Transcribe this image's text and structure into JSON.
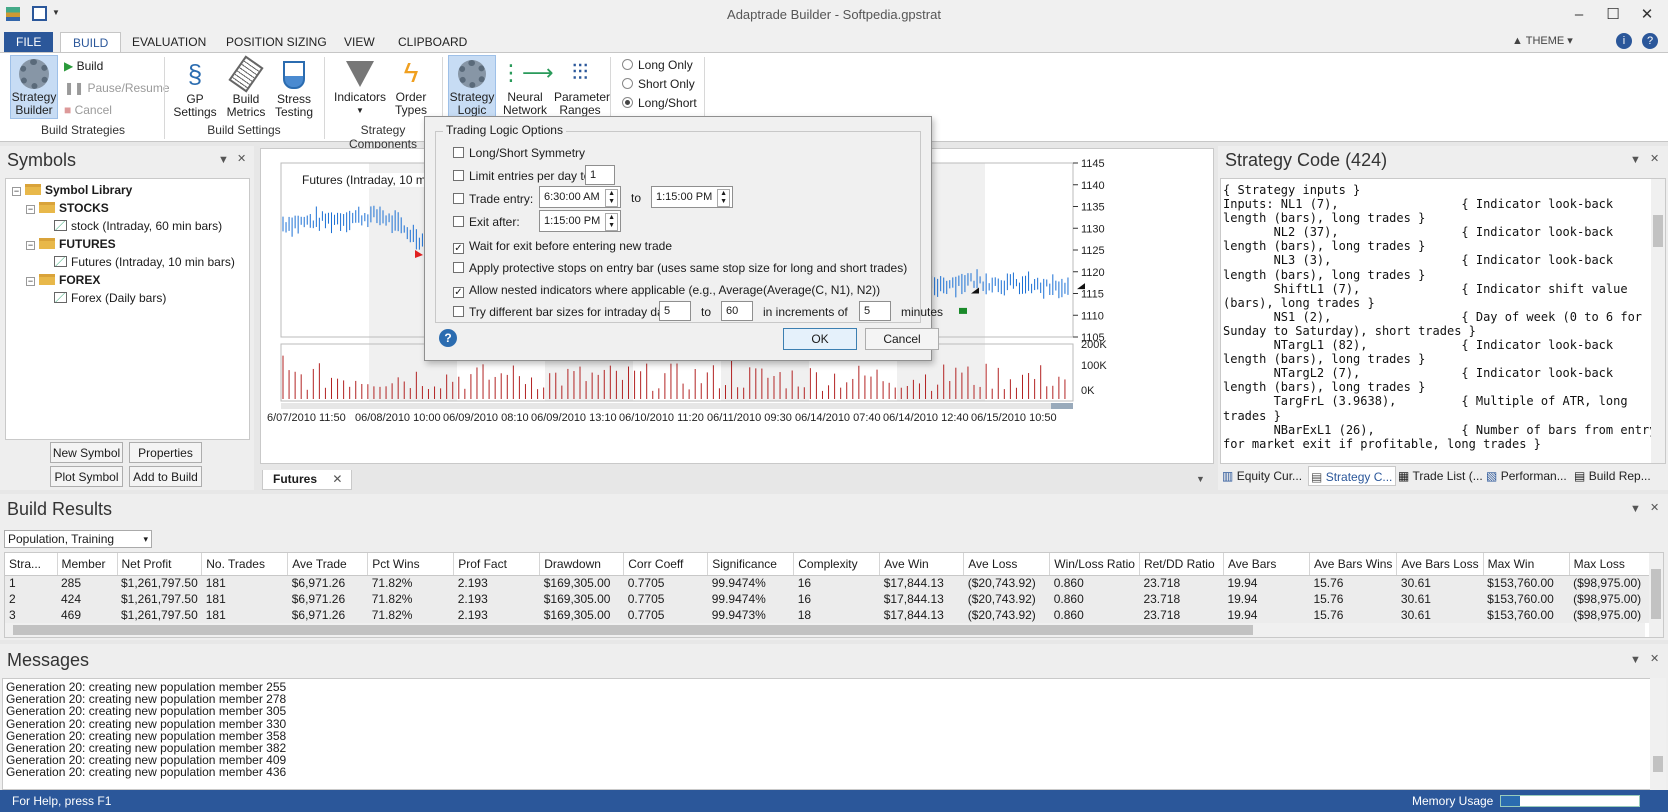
{
  "app": {
    "title": "Adaptrade Builder - Softpedia.gpstrat",
    "theme_label": "THEME"
  },
  "tabs": [
    "FILE",
    "BUILD",
    "EVALUATION",
    "POSITION SIZING",
    "VIEW",
    "CLIPBOARD"
  ],
  "ribbon": {
    "strategy_builder": "Strategy Builder",
    "build": "Build",
    "pause_resume": "Pause/Resume",
    "cancel": "Cancel",
    "group_build_strategies": "Build Strategies",
    "gp_settings": "GP Settings",
    "build_metrics": "Build Metrics",
    "stress_testing": "Stress Testing",
    "group_build_settings": "Build Settings",
    "indicators": "Indicators",
    "order_types": "Order Types",
    "group_strategy_components": "Strategy Components",
    "strategy_logic": "Strategy Logic",
    "neural_network": "Neural Network",
    "parameter_ranges": "Parameter Ranges",
    "long_only": "Long Only",
    "short_only": "Short Only",
    "long_short": "Long/Short",
    "selected_direction": "Long/Short"
  },
  "symbols": {
    "title": "Symbols",
    "library": "Symbol Library",
    "stocks": "STOCKS",
    "stock_item": "stock (Intraday, 60 min bars)",
    "futures": "FUTURES",
    "futures_item": "Futures (Intraday, 10 min bars)",
    "forex": "FOREX",
    "forex_item": "Forex (Daily bars)",
    "new_symbol": "New Symbol",
    "properties": "Properties",
    "plot_symbol": "Plot Symbol",
    "add_to_build": "Add to Build"
  },
  "chart": {
    "legend": "Futures (Intraday, 10 min bars)",
    "tab": "Futures",
    "price_ticks": [
      "1145",
      "1140",
      "1135",
      "1130",
      "1125",
      "1120",
      "1115",
      "1110",
      "1105"
    ],
    "volume_ticks": [
      "200K",
      "100K",
      "0K"
    ],
    "date_ticks": [
      "6/07/2010 11:50",
      "06/08/2010 10:00",
      "06/09/2010 08:10",
      "06/09/2010 13:10",
      "06/10/2010 11:20",
      "06/11/2010 09:30",
      "06/14/2010 07:40",
      "06/14/2010 12:40",
      "06/15/2010 10:50"
    ]
  },
  "chart_data": {
    "type": "line",
    "title": "Futures (Intraday, 10 min bars)",
    "ylim": [
      1105,
      1145
    ],
    "x": [
      "6/07/2010 11:50",
      "06/08/2010 10:00",
      "06/09/2010 08:10",
      "06/09/2010 13:10",
      "06/10/2010 11:20",
      "06/11/2010 09:30",
      "06/14/2010 07:40",
      "06/14/2010 12:40",
      "06/15/2010 10:50"
    ],
    "series": [
      {
        "values": [
          1131,
          1133,
          1119,
          1118,
          1117,
          1116,
          1115,
          1118,
          1116
        ]
      }
    ]
  },
  "dialog": {
    "group_title": "Trading Logic Options",
    "long_short_symmetry": "Long/Short Symmetry",
    "limit_entries": "Limit entries per day to",
    "limit_entries_value": "1",
    "trade_entry": "Trade entry:",
    "trade_entry_from": "6:30:00 AM",
    "to": "to",
    "trade_entry_to": "1:15:00 PM",
    "exit_after": "Exit after:",
    "exit_after_value": "1:15:00 PM",
    "wait_for_exit": "Wait for exit before entering new trade",
    "protective_stops": "Apply protective stops on entry bar (uses same stop size for long and short trades)",
    "nested_indicators": "Allow nested indicators where applicable (e.g., Average(Average(C, N1), N2))",
    "bar_sizes": "Try different bar sizes for intraday data:",
    "bar_from": "5",
    "bar_to_label": "to",
    "bar_to": "60",
    "increments": "in increments of",
    "increment_value": "5",
    "minutes": "minutes",
    "ok": "OK",
    "cancel": "Cancel"
  },
  "strategy_code": {
    "title": "Strategy Code (424)",
    "text": "{ Strategy inputs }\nInputs: NL1 (7),                 { Indicator look-back\nlength (bars), long trades }\n       NL2 (37),                 { Indicator look-back\nlength (bars), long trades }\n       NL3 (3),                  { Indicator look-back\nlength (bars), long trades }\n       ShiftL1 (7),              { Indicator shift value\n(bars), long trades }\n       NS1 (2),                  { Day of week (0 to 6 for\nSunday to Saturday), short trades }\n       NTargL1 (82),             { Indicator look-back\nlength (bars), long trades }\n       NTargL2 (7),              { Indicator look-back\nlength (bars), long trades }\n       TargFrL (3.9638),         { Multiple of ATR, long\ntrades }\n       NBarExL1 (26),            { Number of bars from entry\nfor market exit if profitable, long trades }",
    "tabs": [
      "Equity Cur...",
      "Strategy C...",
      "Trade List (...",
      "Performan...",
      "Build Rep..."
    ]
  },
  "build_results": {
    "title": "Build Results",
    "dropdown": "Population, Training",
    "columns": [
      "Stra...",
      "Member",
      "Net Profit",
      "No. Trades",
      "Ave Trade",
      "Pct Wins",
      "Prof Fact",
      "Drawdown",
      "Corr Coeff",
      "Significance",
      "Complexity",
      "Ave Win",
      "Ave Loss",
      "Win/Loss Ratio",
      "Ret/DD Ratio",
      "Ave Bars",
      "Ave Bars Wins",
      "Ave Bars Loss",
      "Max Win",
      "Max Loss"
    ],
    "rows": [
      [
        "1",
        "285",
        "$1,261,797.50",
        "181",
        "$6,971.26",
        "71.82%",
        "2.193",
        "$169,305.00",
        "0.7705",
        "99.9474%",
        "16",
        "$17,844.13",
        "($20,743.92)",
        "0.860",
        "23.718",
        "19.94",
        "15.76",
        "30.61",
        "$153,760.00",
        "($98,975.00)"
      ],
      [
        "2",
        "424",
        "$1,261,797.50",
        "181",
        "$6,971.26",
        "71.82%",
        "2.193",
        "$169,305.00",
        "0.7705",
        "99.9474%",
        "16",
        "$17,844.13",
        "($20,743.92)",
        "0.860",
        "23.718",
        "19.94",
        "15.76",
        "30.61",
        "$153,760.00",
        "($98,975.00)"
      ],
      [
        "3",
        "469",
        "$1,261,797.50",
        "181",
        "$6,971.26",
        "71.82%",
        "2.193",
        "$169,305.00",
        "0.7705",
        "99.9473%",
        "18",
        "$17,844.13",
        "($20,743.92)",
        "0.860",
        "23.718",
        "19.94",
        "15.76",
        "30.61",
        "$153,760.00",
        "($98,975.00)"
      ]
    ]
  },
  "messages": {
    "title": "Messages",
    "lines": [
      "Generation 20: creating new population member 255",
      "Generation 20: creating new population member 278",
      "Generation 20: creating new population member 305",
      "Generation 20: creating new population member 330",
      "Generation 20: creating new population member 358",
      "Generation 20: creating new population member 382",
      "Generation 20: creating new population member 409",
      "Generation 20: creating new population member 436"
    ]
  },
  "status": {
    "help": "For Help, press F1",
    "memory_label": "Memory Usage",
    "memory_fraction": 0.14
  },
  "colors": {
    "accent": "#2b579a",
    "bar_up": "#1a6fd4",
    "volume": "#b22222"
  }
}
